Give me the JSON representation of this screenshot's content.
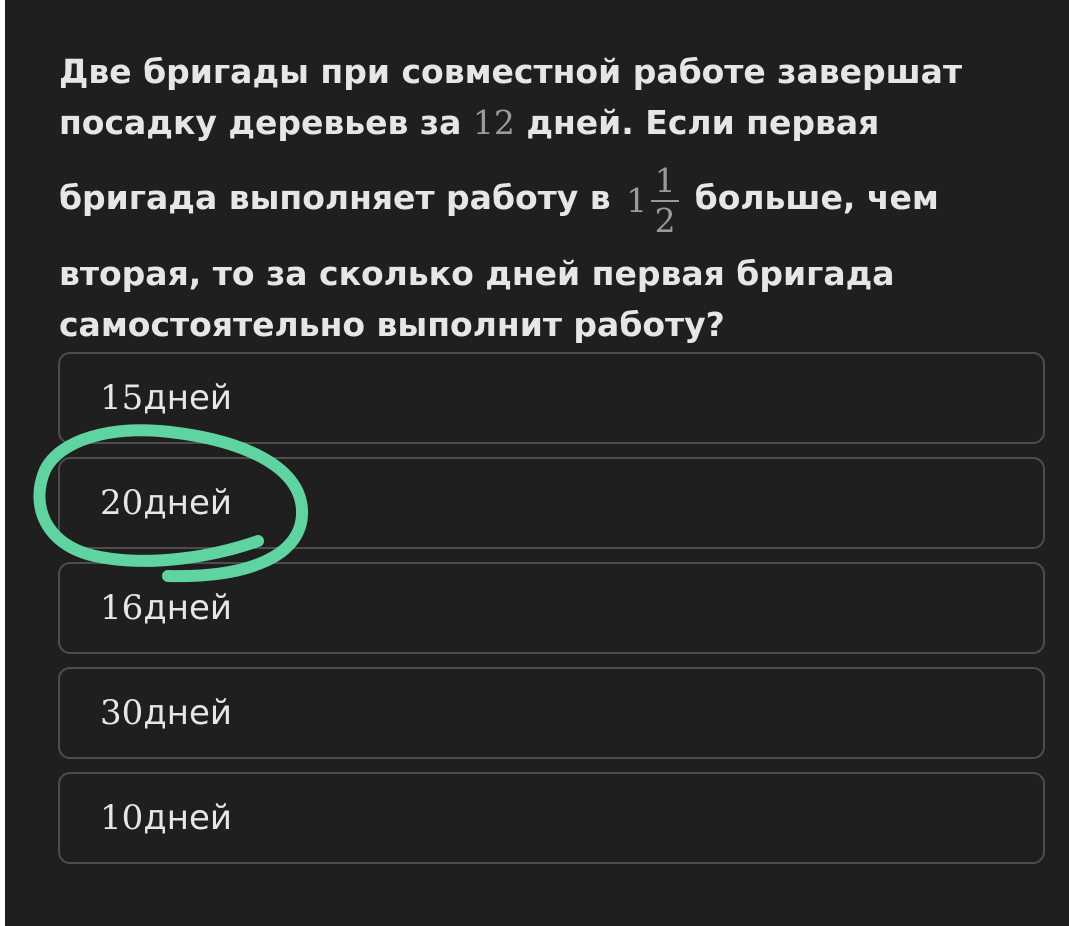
{
  "question": {
    "part1": "Две бригады при совместной работе завершат посадку деревьев за ",
    "days_total": "12",
    "part2": " дней. Если первая",
    "part3": "бригада выполняет работу в ",
    "mixed_whole": "1",
    "mixed_num": "1",
    "mixed_den": "2",
    "part4": " больше, чем",
    "part5": "вторая, то за сколько дней первая бригада самостоятельно выполнит работу?"
  },
  "options": [
    {
      "num": "15",
      "unit": " дней"
    },
    {
      "num": "20",
      "unit": " дней"
    },
    {
      "num": "16",
      "unit": " дней"
    },
    {
      "num": "30",
      "unit": " дней"
    },
    {
      "num": "10",
      "unit": " дней"
    }
  ],
  "colors": {
    "background": "#1f1f1f",
    "text": "#e6e6e6",
    "math": "#9a9a9a",
    "border": "#4d4d4d",
    "annotation": "#5fd3a0"
  }
}
